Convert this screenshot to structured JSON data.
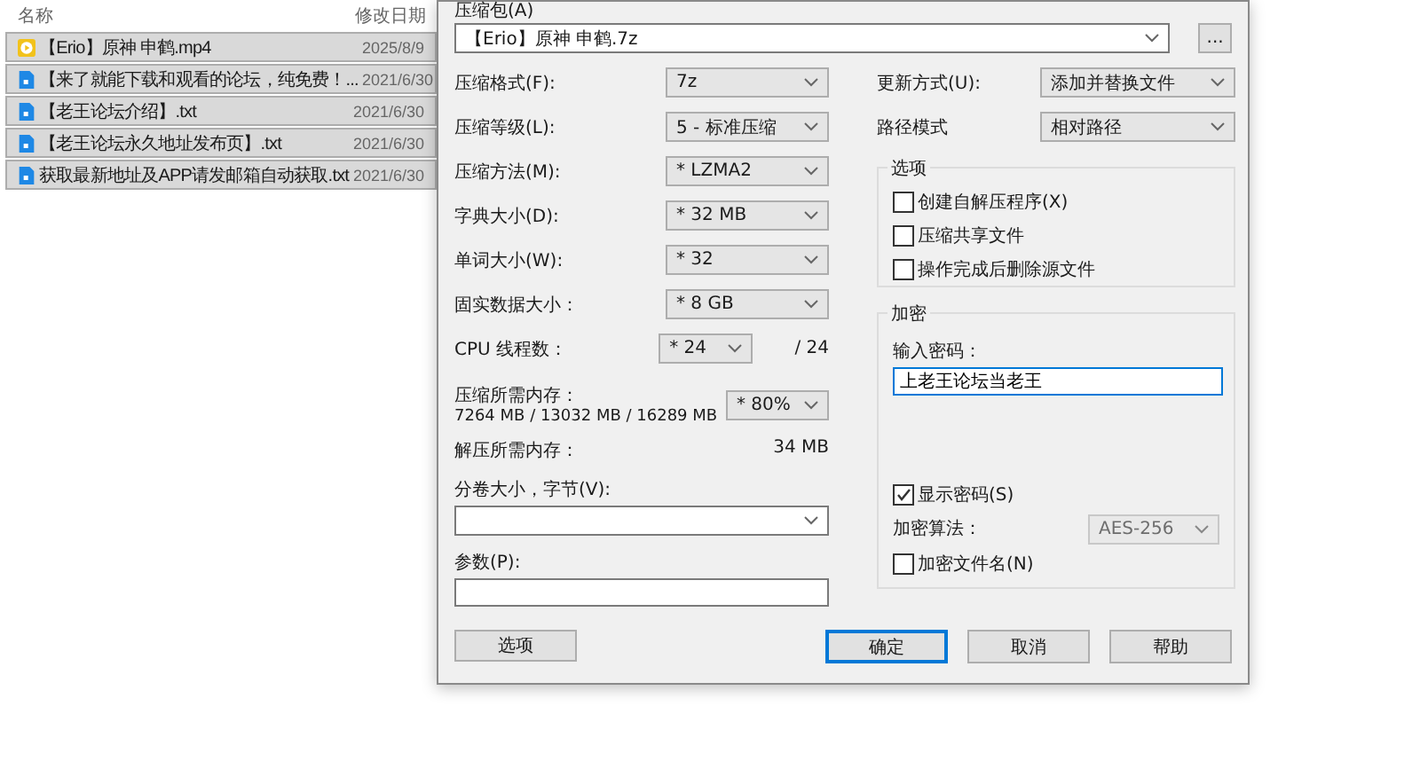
{
  "file_list": {
    "columns": [
      "名称",
      "修改日期"
    ],
    "rows": [
      {
        "name": "【Erio】原神 申鹤.mp4",
        "date": "2025/8/9",
        "kind": "video",
        "selected": true
      },
      {
        "name": "【来了就能下载和观看的论坛，纯免费！...",
        "date": "2021/6/30",
        "kind": "text",
        "selected": true
      },
      {
        "name": "【老王论坛介绍】.txt",
        "date": "2021/6/30",
        "kind": "text",
        "selected": true
      },
      {
        "name": "【老王论坛永久地址发布页】.txt",
        "date": "2021/6/30",
        "kind": "text",
        "selected": true
      },
      {
        "name": "获取最新地址及APP请发邮箱自动获取.txt",
        "date": "2021/6/30",
        "kind": "text",
        "selected": true
      }
    ]
  },
  "dialog": {
    "archive": {
      "label": "压缩包(A)",
      "value": "【Erio】原神 申鹤.7z",
      "browse": "..."
    },
    "left_fields": [
      {
        "label": "压缩格式(F):",
        "value": "7z"
      },
      {
        "label": "压缩等级(L):",
        "value": "5 - 标准压缩"
      },
      {
        "label": "压缩方法(M):",
        "value": "* LZMA2"
      },
      {
        "label": "字典大小(D):",
        "value": "* 32 MB"
      },
      {
        "label": "单词大小(W):",
        "value": "* 32"
      },
      {
        "label": "固实数据大小：",
        "value": "* 8 GB"
      },
      {
        "label": "CPU 线程数：",
        "value": "* 24",
        "note": "/ 24"
      }
    ],
    "memory": {
      "label": "压缩所需内存：",
      "detail": "7264 MB / 13032 MB / 16289 MB",
      "value": "* 80%"
    },
    "decompress_memory": {
      "label": "解压所需内存：",
      "value": "34 MB"
    },
    "volume": {
      "label": "分卷大小，字节(V):"
    },
    "parameters": {
      "label": "参数(P):"
    },
    "options_button": "选项",
    "update_mode": {
      "label": "更新方式(U):",
      "value": "添加并替换文件"
    },
    "path_mode": {
      "label": "路径模式",
      "value": "相对路径"
    },
    "options": {
      "title": "选项",
      "items": [
        {
          "label": "创建自解压程序(X)",
          "checked": false
        },
        {
          "label": "压缩共享文件",
          "checked": false
        },
        {
          "label": "操作完成后删除源文件",
          "checked": false
        }
      ]
    },
    "encryption": {
      "title": "加密",
      "password_label": "输入密码：",
      "password": "上老王论坛当老王",
      "show_password": {
        "label": "显示密码(S)",
        "checked": true
      },
      "method": {
        "label": "加密算法：",
        "value": "AES-256",
        "disabled": true
      },
      "encrypt_names": {
        "label": "加密文件名(N)",
        "checked": false
      }
    },
    "buttons": [
      {
        "label": "确定",
        "default": true
      },
      {
        "label": "取消",
        "default": false
      },
      {
        "label": "帮助",
        "default": false
      }
    ]
  }
}
